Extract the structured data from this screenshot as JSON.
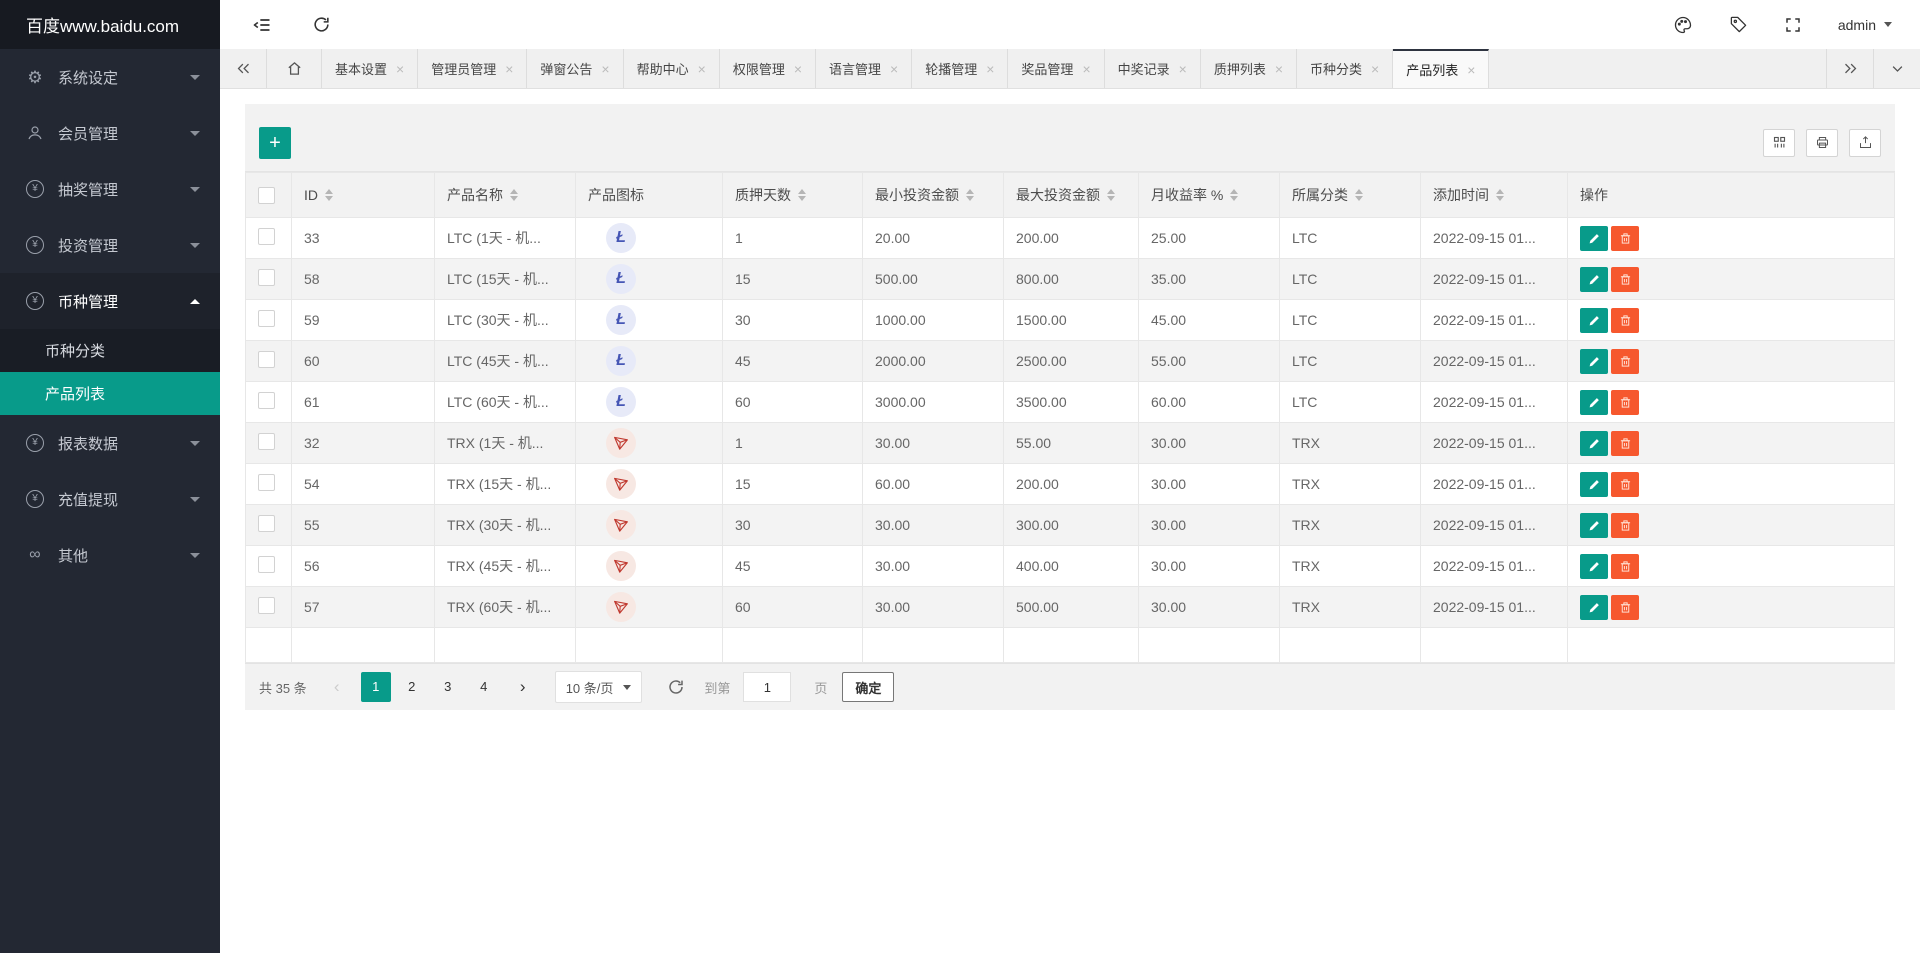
{
  "app": {
    "logo": "百度www.baidu.com",
    "user": "admin"
  },
  "sidebar": {
    "items": [
      {
        "id": "system-settings",
        "label": "系统设定",
        "icon": "gear-icon"
      },
      {
        "id": "member-management",
        "label": "会员管理",
        "icon": "user-icon"
      },
      {
        "id": "lottery-management",
        "label": "抽奖管理",
        "icon": "yen-icon"
      },
      {
        "id": "investment-management",
        "label": "投资管理",
        "icon": "yen-icon"
      },
      {
        "id": "coin-management",
        "label": "币种管理",
        "icon": "yen-icon",
        "expanded": true,
        "children": [
          {
            "id": "coin-category",
            "label": "币种分类",
            "active": false
          },
          {
            "id": "product-list",
            "label": "产品列表",
            "active": true
          }
        ]
      },
      {
        "id": "report-data",
        "label": "报表数据",
        "icon": "yen-icon"
      },
      {
        "id": "recharge-withdraw",
        "label": "充值提现",
        "icon": "yen-icon"
      },
      {
        "id": "other",
        "label": "其他",
        "icon": "infinity-icon"
      }
    ]
  },
  "tabs": {
    "items": [
      {
        "id": "basic-settings",
        "label": "基本设置"
      },
      {
        "id": "admin-management",
        "label": "管理员管理"
      },
      {
        "id": "popup-announcement",
        "label": "弹窗公告"
      },
      {
        "id": "help-center",
        "label": "帮助中心"
      },
      {
        "id": "permission-management",
        "label": "权限管理"
      },
      {
        "id": "language-management",
        "label": "语言管理"
      },
      {
        "id": "carousel-management",
        "label": "轮播管理"
      },
      {
        "id": "prize-management",
        "label": "奖品管理"
      },
      {
        "id": "winning-records",
        "label": "中奖记录"
      },
      {
        "id": "pledge-list",
        "label": "质押列表"
      },
      {
        "id": "coin-category",
        "label": "币种分类"
      },
      {
        "id": "product-list",
        "label": "产品列表",
        "active": true
      }
    ]
  },
  "toolbar": {
    "add_label": "+",
    "right_buttons": [
      "columns-icon",
      "printer-icon",
      "export-icon"
    ]
  },
  "table": {
    "columns": [
      {
        "key": "checkbox",
        "label": "",
        "sortable": false
      },
      {
        "key": "id",
        "label": "ID",
        "sortable": true
      },
      {
        "key": "name",
        "label": "产品名称",
        "sortable": true
      },
      {
        "key": "icon",
        "label": "产品图标",
        "sortable": false
      },
      {
        "key": "days",
        "label": "质押天数",
        "sortable": true
      },
      {
        "key": "min",
        "label": "最小投资金额",
        "sortable": true
      },
      {
        "key": "max",
        "label": "最大投资金额",
        "sortable": true
      },
      {
        "key": "rate",
        "label": "月收益率 %",
        "sortable": true
      },
      {
        "key": "category",
        "label": "所属分类",
        "sortable": true
      },
      {
        "key": "time",
        "label": "添加时间",
        "sortable": true
      },
      {
        "key": "actions",
        "label": "操作",
        "sortable": false
      }
    ],
    "rows": [
      {
        "id": "33",
        "name": "LTC (1天 - 机...",
        "coin": "LTC",
        "days": "1",
        "min": "20.00",
        "max": "200.00",
        "rate": "25.00",
        "category": "LTC",
        "time": "2022-09-15 01..."
      },
      {
        "id": "58",
        "name": "LTC (15天 - 机...",
        "coin": "LTC",
        "days": "15",
        "min": "500.00",
        "max": "800.00",
        "rate": "35.00",
        "category": "LTC",
        "time": "2022-09-15 01..."
      },
      {
        "id": "59",
        "name": "LTC (30天 - 机...",
        "coin": "LTC",
        "days": "30",
        "min": "1000.00",
        "max": "1500.00",
        "rate": "45.00",
        "category": "LTC",
        "time": "2022-09-15 01..."
      },
      {
        "id": "60",
        "name": "LTC (45天 - 机...",
        "coin": "LTC",
        "days": "45",
        "min": "2000.00",
        "max": "2500.00",
        "rate": "55.00",
        "category": "LTC",
        "time": "2022-09-15 01..."
      },
      {
        "id": "61",
        "name": "LTC (60天 - 机...",
        "coin": "LTC",
        "days": "60",
        "min": "3000.00",
        "max": "3500.00",
        "rate": "60.00",
        "category": "LTC",
        "time": "2022-09-15 01..."
      },
      {
        "id": "32",
        "name": "TRX (1天 - 机...",
        "coin": "TRX",
        "days": "1",
        "min": "30.00",
        "max": "55.00",
        "rate": "30.00",
        "category": "TRX",
        "time": "2022-09-15 01..."
      },
      {
        "id": "54",
        "name": "TRX (15天 - 机...",
        "coin": "TRX",
        "days": "15",
        "min": "60.00",
        "max": "200.00",
        "rate": "30.00",
        "category": "TRX",
        "time": "2022-09-15 01..."
      },
      {
        "id": "55",
        "name": "TRX (30天 - 机...",
        "coin": "TRX",
        "days": "30",
        "min": "30.00",
        "max": "300.00",
        "rate": "30.00",
        "category": "TRX",
        "time": "2022-09-15 01..."
      },
      {
        "id": "56",
        "name": "TRX (45天 - 机...",
        "coin": "TRX",
        "days": "45",
        "min": "30.00",
        "max": "400.00",
        "rate": "30.00",
        "category": "TRX",
        "time": "2022-09-15 01..."
      },
      {
        "id": "57",
        "name": "TRX (60天 - 机...",
        "coin": "TRX",
        "days": "60",
        "min": "30.00",
        "max": "500.00",
        "rate": "30.00",
        "category": "TRX",
        "time": "2022-09-15 01..."
      }
    ]
  },
  "pagination": {
    "total_label": "共 35 条",
    "pages": [
      "1",
      "2",
      "3",
      "4"
    ],
    "active_page": "1",
    "page_size": "10 条/页",
    "goto_label": "到第",
    "goto_value": "1",
    "page_label": "页",
    "confirm_label": "确定"
  },
  "colors": {
    "accent": "#089b8a",
    "danger": "#f6582e",
    "sidebar_bg": "#232833",
    "ltc_fg": "#4656b5",
    "ltc_bg": "#e7eaf8",
    "trx_fg": "#c0392f",
    "trx_bg": "#f7e8e3"
  }
}
